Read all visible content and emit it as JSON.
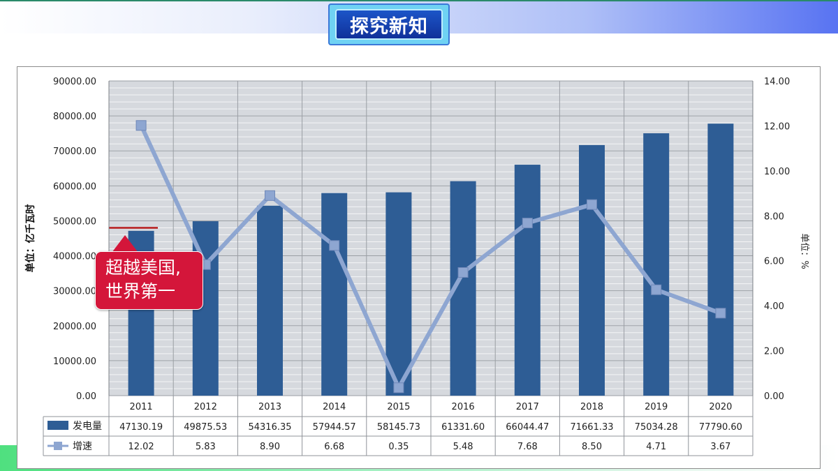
{
  "header": {
    "title": "探究新知"
  },
  "callout": {
    "line1": "超越美国,",
    "line2": "世界第一"
  },
  "colors": {
    "bar": "#2e5d95",
    "line": "#8ea6d1",
    "marker": "#8ea6d1",
    "highlight": "#b81c1c",
    "callout_bg": "#d4163a"
  },
  "chart_data": {
    "type": "bar",
    "categories": [
      "2011",
      "2012",
      "2013",
      "2014",
      "2015",
      "2016",
      "2017",
      "2018",
      "2019",
      "2020"
    ],
    "series": [
      {
        "name": "发电量",
        "type": "bar",
        "axis": "left",
        "values": [
          47130.19,
          49875.53,
          54316.35,
          57944.57,
          58145.73,
          61331.6,
          66044.47,
          71661.33,
          75034.28,
          77790.6
        ],
        "labels": [
          "47130.19",
          "49875.53",
          "54316.35",
          "57944.57",
          "58145.73",
          "61331.60",
          "66044.47",
          "71661.33",
          "75034.28",
          "77790.60"
        ]
      },
      {
        "name": "增速",
        "type": "line",
        "axis": "right",
        "values": [
          12.02,
          5.83,
          8.9,
          6.68,
          0.35,
          5.48,
          7.68,
          8.5,
          4.71,
          3.67
        ],
        "labels": [
          "12.02",
          "5.83",
          "8.90",
          "6.68",
          "0.35",
          "5.48",
          "7.68",
          "8.50",
          "4.71",
          "3.67"
        ]
      }
    ],
    "y_left": {
      "label": "单位：亿千瓦时",
      "min": 0,
      "max": 90000,
      "ticks": [
        "0.00",
        "10000.00",
        "20000.00",
        "30000.00",
        "40000.00",
        "50000.00",
        "60000.00",
        "70000.00",
        "80000.00",
        "90000.00"
      ],
      "tick_values": [
        0,
        10000,
        20000,
        30000,
        40000,
        50000,
        60000,
        70000,
        80000,
        90000
      ]
    },
    "y_right": {
      "label": "单位：%",
      "min": 0,
      "max": 14,
      "ticks": [
        "0.00",
        "2.00",
        "4.00",
        "6.00",
        "8.00",
        "10.00",
        "12.00",
        "14.00"
      ],
      "tick_values": [
        0,
        2,
        4,
        6,
        8,
        10,
        12,
        14
      ]
    },
    "grid": true,
    "minor_grid": true,
    "legend": "data-table",
    "annotation_value": 48000
  }
}
